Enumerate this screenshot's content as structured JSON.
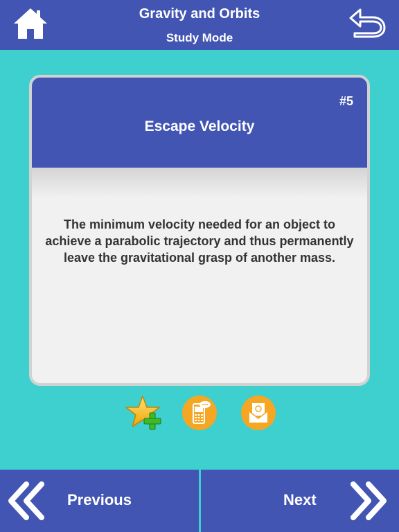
{
  "header": {
    "title": "Gravity and Orbits",
    "subtitle": "Study Mode",
    "home_icon": "home-icon",
    "back_icon": "back-arrow-icon"
  },
  "card": {
    "number": "#5",
    "term": "Escape Velocity",
    "definition": "The minimum velocity needed for an object to achieve a parabolic trajectory and thus permanently leave the gravitational grasp of another mass."
  },
  "actions": {
    "favorite_icon": "star-add-icon",
    "sms_icon": "sms-phone-icon",
    "email_icon": "email-icon"
  },
  "footer": {
    "previous_label": "Previous",
    "next_label": "Next"
  },
  "colors": {
    "background": "#3ecfcf",
    "primary": "#4255b3",
    "card": "#f1f1f1",
    "accent": "#f5a623"
  }
}
